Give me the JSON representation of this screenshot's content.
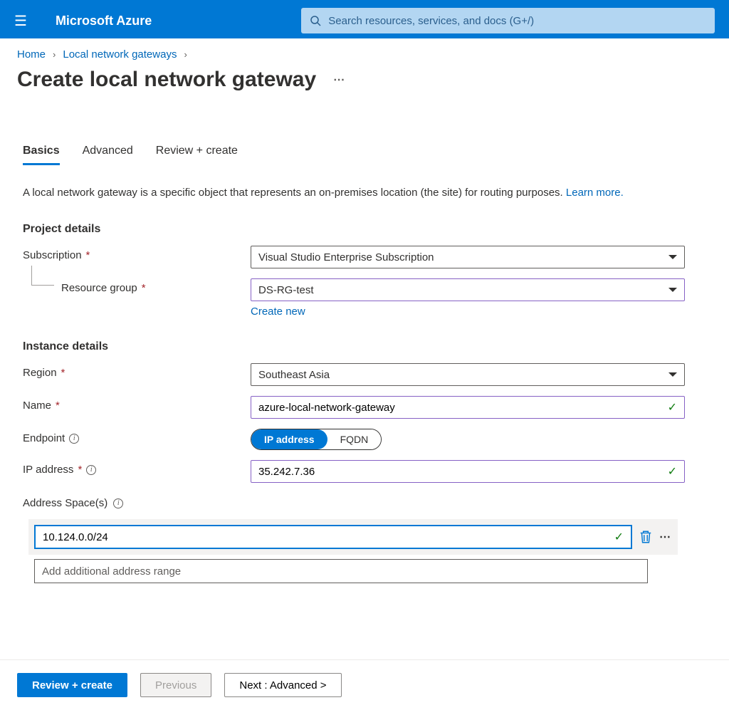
{
  "brand": "Microsoft Azure",
  "search": {
    "placeholder": "Search resources, services, and docs (G+/)"
  },
  "breadcrumb": {
    "home": "Home",
    "parent": "Local network gateways"
  },
  "page_title": "Create local network gateway",
  "tabs": {
    "basics": "Basics",
    "advanced": "Advanced",
    "review": "Review + create"
  },
  "description": {
    "text": "A local network gateway is a specific object that represents an on-premises location (the site) for routing purposes.  ",
    "link": "Learn more."
  },
  "sections": {
    "project": "Project details",
    "instance": "Instance details"
  },
  "labels": {
    "subscription": "Subscription",
    "resource_group": "Resource group",
    "create_new": "Create new",
    "region": "Region",
    "name": "Name",
    "endpoint": "Endpoint",
    "ip_address": "IP address",
    "address_spaces": "Address Space(s)"
  },
  "values": {
    "subscription": "Visual Studio Enterprise Subscription",
    "resource_group": "DS-RG-test",
    "region": "Southeast Asia",
    "name": "azure-local-network-gateway",
    "ip_address": "35.242.7.36",
    "address_range": "10.124.0.0/24",
    "address_placeholder": "Add additional address range"
  },
  "endpoint_options": {
    "ip": "IP address",
    "fqdn": "FQDN"
  },
  "footer": {
    "review": "Review + create",
    "previous": "Previous",
    "next": "Next : Advanced >"
  }
}
